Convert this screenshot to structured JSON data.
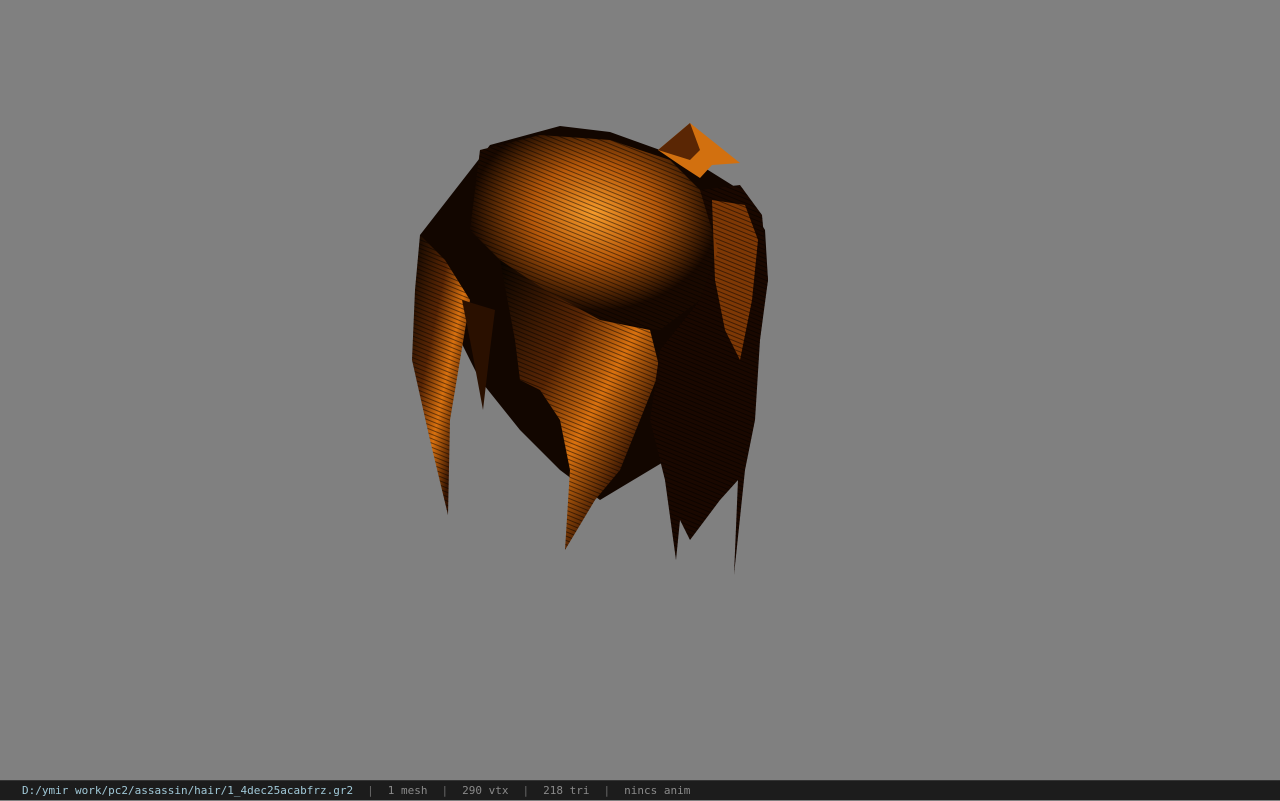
{
  "window": {
    "viewport_background": "#808080"
  },
  "model": {
    "description_name": "hair-mesh",
    "colors": {
      "dark": "#0a0400",
      "mid": "#6b2e04",
      "highlight": "#e07a12",
      "bright": "#f59a2a"
    }
  },
  "status_bar": {
    "file_path": "D:/ymir work/pc2/assassin/hair/1_4dec25acabfrz.gr2",
    "separator": "|",
    "mesh_count": "1 mesh",
    "vertex_count": "290 vtx",
    "triangle_count": "218 tri",
    "anim_status": "nincs anim"
  }
}
